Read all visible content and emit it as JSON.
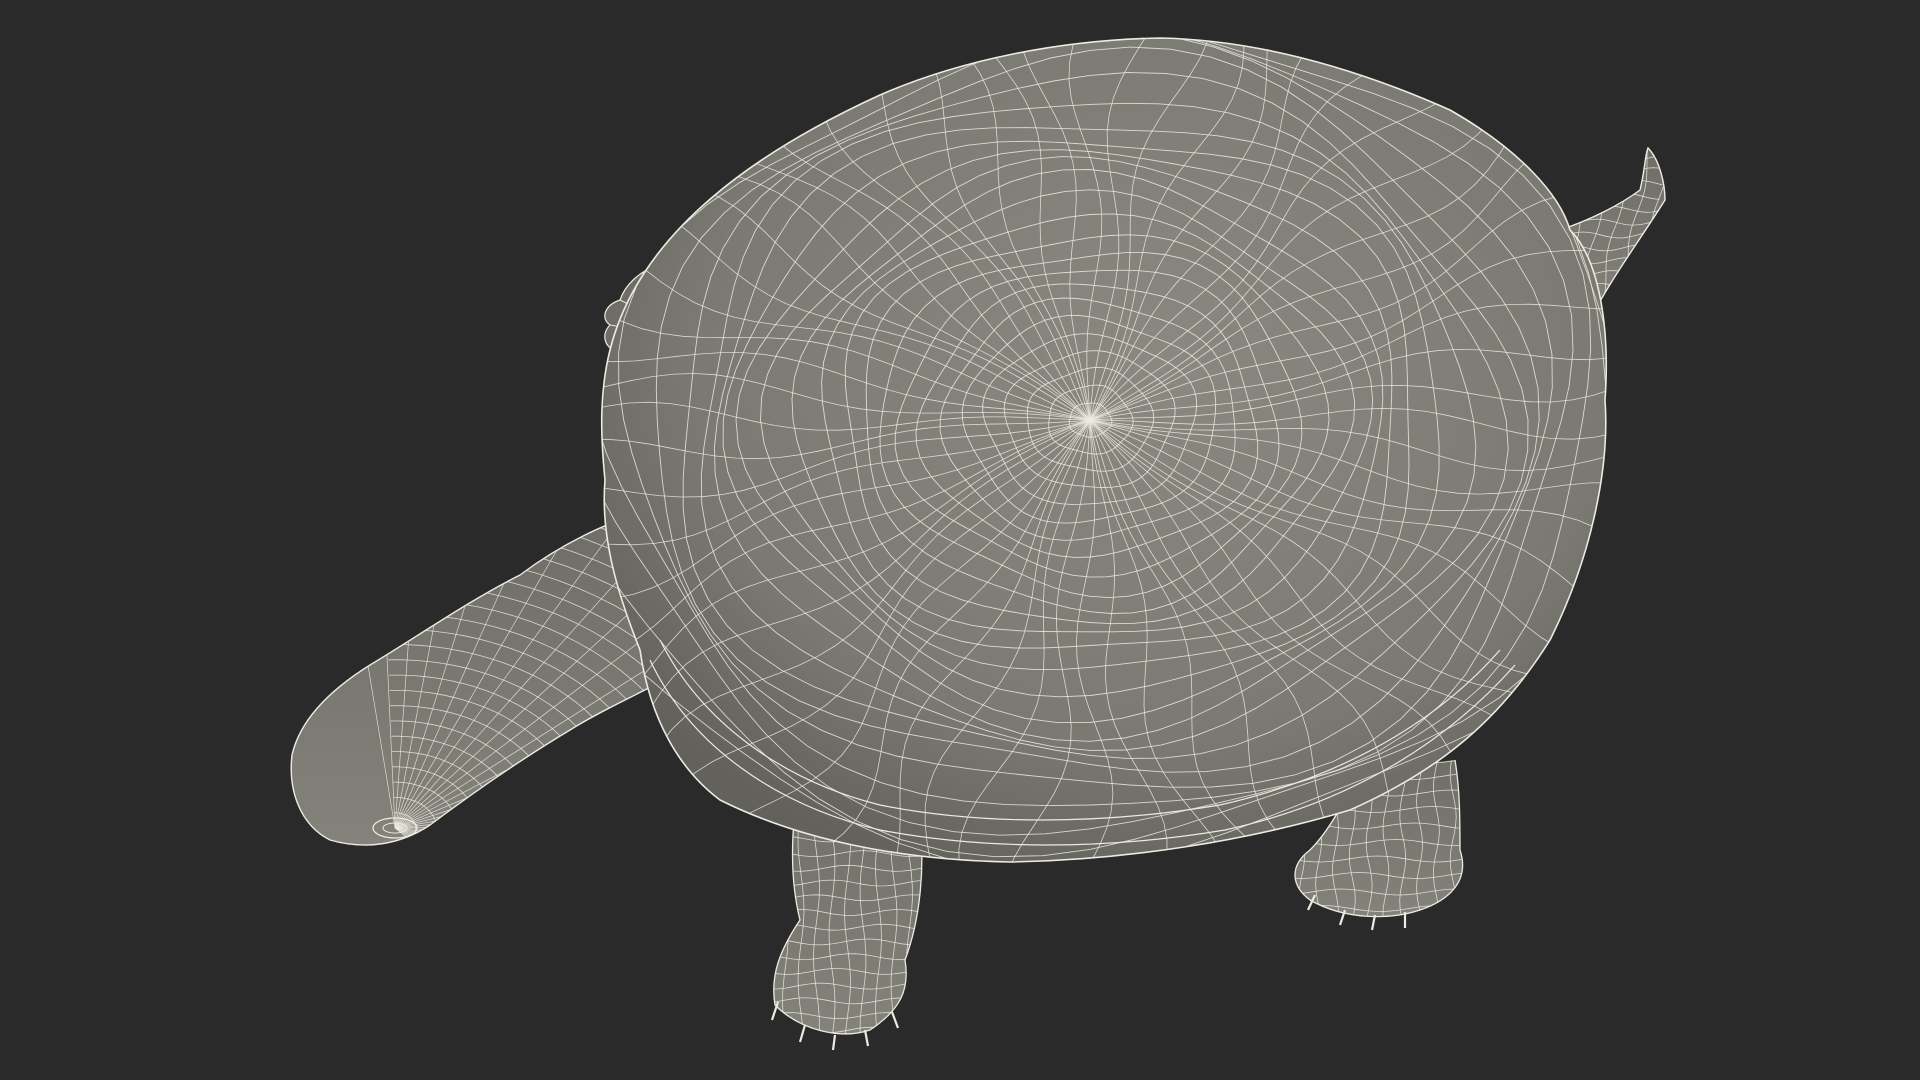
{
  "scene": {
    "background_color": "#2a2a2a",
    "model_fill_color": "#7d7c74",
    "model_shade_color": "#5f5e58",
    "wire_color": "#ecebe2",
    "subject_icon": "turtle-wireframe-icon"
  }
}
